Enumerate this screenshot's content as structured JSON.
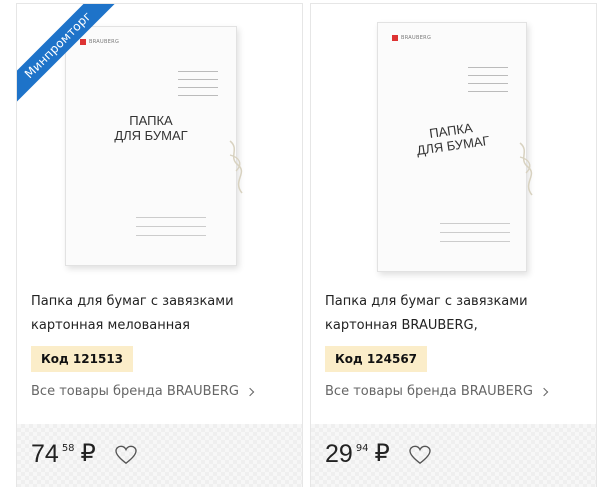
{
  "products": [
    {
      "ribbon": "Минпромторг",
      "image_alt": "Папка для бумаг с завязками",
      "folder_brand": "BRAUBERG",
      "folder_title_line1": "ПАПКА",
      "folder_title_line2": "ДЛЯ БУМАГ",
      "name_line1": "Папка для бумаг с завязками",
      "name_line2": "картонная мелованная",
      "code": "Код 121513",
      "brand_link": "Все товары бренда BRAUBERG",
      "price_int": "74",
      "price_frac": "58",
      "currency": "₽",
      "favorite_icon": "heart-icon"
    },
    {
      "image_alt": "Папка для бумаг с завязками",
      "folder_brand": "BRAUBERG",
      "folder_title_line1": "ПАПКА",
      "folder_title_line2": "ДЛЯ БУМАГ",
      "name_line1": "Папка для бумаг с завязками",
      "name_line2": "картонная BRAUBERG,",
      "code": "Код 124567",
      "brand_link": "Все товары бренда BRAUBERG",
      "price_int": "29",
      "price_frac": "94",
      "currency": "₽",
      "favorite_icon": "heart-icon"
    }
  ],
  "colors": {
    "ribbon_bg": "#1e73c9",
    "code_badge_bg": "#fbedc9",
    "brand_link_text": "#666666"
  }
}
